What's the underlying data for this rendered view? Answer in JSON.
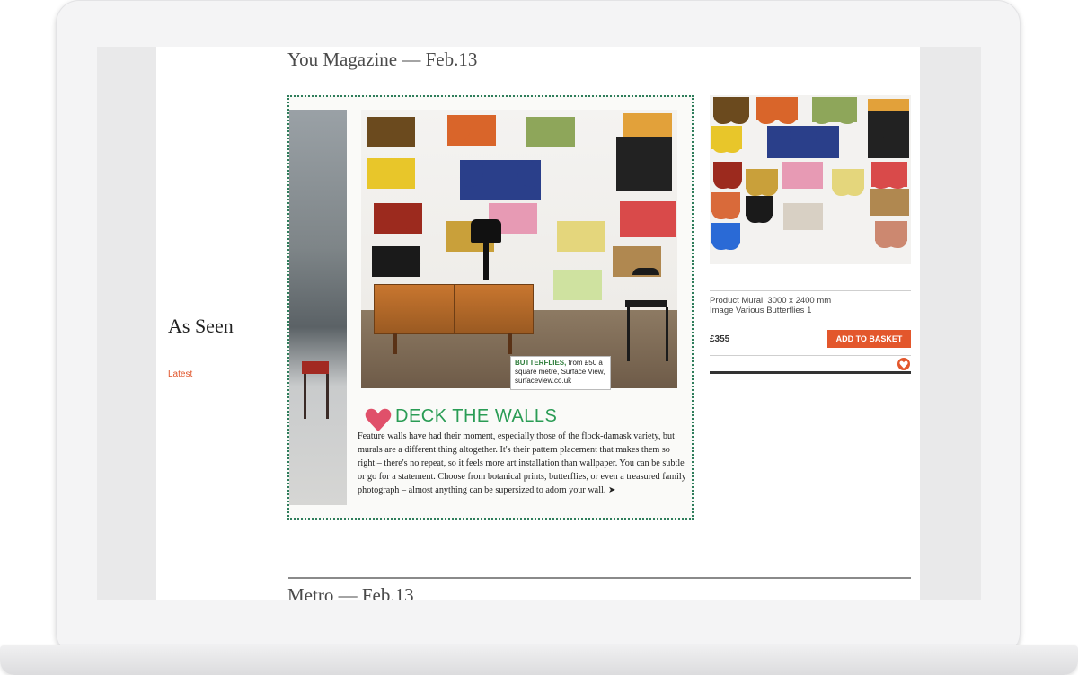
{
  "sidebar": {
    "title": "As Seen",
    "link": "Latest"
  },
  "sections": [
    {
      "heading": "You Magazine — Feb.13"
    },
    {
      "heading": "Metro — Feb.13"
    }
  ],
  "clipping": {
    "caption_lead": "BUTTERFLIES,",
    "caption_rest": "from £50 a square metre, Surface View, surfaceview.co.uk",
    "title": "DECK THE WALLS",
    "body": "Feature walls have had their moment, especially those of the flock-damask variety, but murals are a different thing altogether. It's their pattern placement that makes them so right – there's no repeat, so it feels more art installation than wallpaper. You can be subtle or go for a statement. Choose from botanical prints, butterflies, or even a treasured family photograph – almost anything can be supersized to adorn your wall.",
    "arrow": "➤"
  },
  "product": {
    "name": "Product Mural, 3000 x 2400 mm",
    "image_caption": "Image Various Butterflies 1",
    "price": "£355",
    "button_label": "ADD TO BASKET"
  },
  "icons": {
    "heart": "heart-icon",
    "favourite": "favourite-heart-icon"
  },
  "colors": {
    "accent": "#e3572c",
    "clip_title": "#2a9c55",
    "heart": "#e0506a"
  }
}
